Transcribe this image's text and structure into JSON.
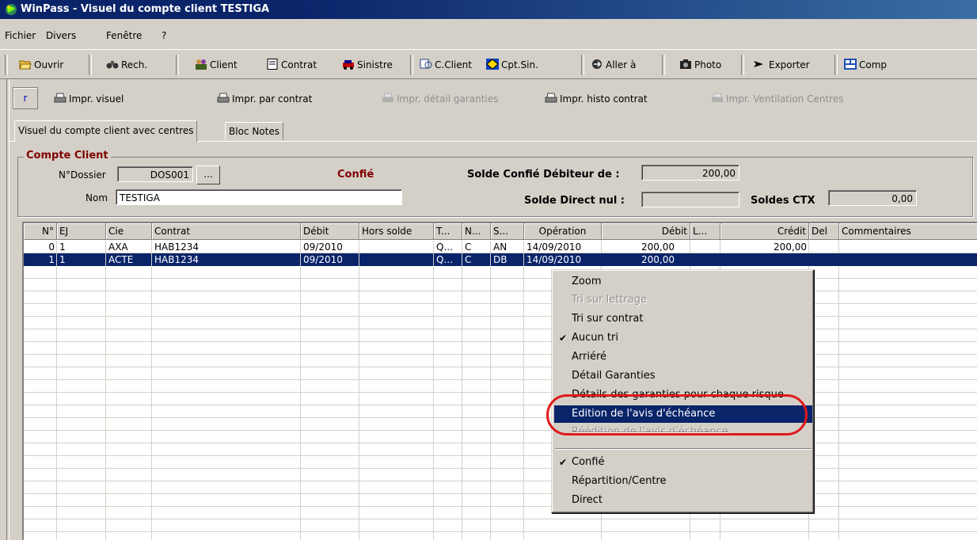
{
  "window": {
    "title": "WinPass - Visuel du compte client TESTIGA",
    "title_icon": "winpass-logo-icon"
  },
  "menu": [
    "Fichier",
    "Divers",
    "Fenêtre",
    "?"
  ],
  "toolbar": [
    {
      "label": "Ouvrir",
      "icon": "open-folder-icon"
    },
    {
      "label": "Rech.",
      "icon": "binoculars-icon"
    },
    {
      "label": "Client",
      "icon": "client-people-icon"
    },
    {
      "label": "Contrat",
      "icon": "document-icon"
    },
    {
      "label": "Sinistre",
      "icon": "car-crash-icon"
    },
    {
      "label": "C.Client",
      "icon": "account-icon"
    },
    {
      "label": "Cpt.Sin.",
      "icon": "warning-sign-icon"
    },
    {
      "label": "Aller à",
      "icon": "goto-icon"
    },
    {
      "label": "Photo",
      "icon": "camera-icon"
    },
    {
      "label": "Exporter",
      "icon": "export-arrow-icon"
    },
    {
      "label": "Comp",
      "icon": "compare-icon"
    }
  ],
  "print_toolbar": {
    "r_label": "r",
    "items": [
      {
        "label": "Impr. visuel",
        "enabled": true
      },
      {
        "label": "Impr. par contrat",
        "enabled": true
      },
      {
        "label": "Impr. détail garanties",
        "enabled": false
      },
      {
        "label": "Impr. histo contrat",
        "enabled": true
      },
      {
        "label": "Impr. Ventilation Centres",
        "enabled": false
      }
    ]
  },
  "tabs": [
    "Visuel du compte client avec centres",
    "Bloc Notes"
  ],
  "account": {
    "group_title": "Compte Client",
    "dossier_label": "N°Dossier",
    "dossier_value": "DOS001",
    "browse_label": "...",
    "confie_label": "Confié",
    "nom_label": "Nom",
    "nom_value": "TESTIGA",
    "solde_confie_label": "Solde Confié Débiteur de :",
    "solde_confie_value": "200,00",
    "solde_direct_label": "Solde Direct nul :",
    "solde_direct_value": "",
    "soldes_ctx_label": "Soldes CTX",
    "soldes_ctx_value": "0,00"
  },
  "table": {
    "headers": [
      "N°",
      "EJ",
      "Cie",
      "Contrat",
      "Débit",
      "Hors solde",
      "T...",
      "N...",
      "S...",
      "Opération",
      "Débit",
      "L...",
      "Crédit",
      "Del",
      "Commentaires"
    ],
    "rows": [
      {
        "n": "0",
        "ej": "1",
        "cie": "AXA",
        "contrat": "HAB1234",
        "debit_period": "09/2010",
        "hors_solde": "",
        "t": "Q...",
        "nn": "C",
        "s": "AN",
        "operation": "14/09/2010",
        "debit": "200,00",
        "l": "",
        "credit": "200,00",
        "del": "",
        "commentaires": ""
      },
      {
        "n": "1",
        "ej": "1",
        "cie": "ACTE",
        "contrat": "HAB1234",
        "debit_period": "09/2010",
        "hors_solde": "",
        "t": "Q...",
        "nn": "C",
        "s": "DB",
        "operation": "14/09/2010",
        "debit": "200,00",
        "l": "",
        "credit": "",
        "del": "",
        "commentaires": ""
      }
    ]
  },
  "context_menu": {
    "items": [
      {
        "label": "Zoom",
        "state": "normal",
        "checked": false
      },
      {
        "label": "Tri sur lettrage",
        "state": "disabled",
        "checked": false
      },
      {
        "label": "Tri sur contrat",
        "state": "normal",
        "checked": false
      },
      {
        "label": "Aucun tri",
        "state": "normal",
        "checked": true
      },
      {
        "label": "Arriéré",
        "state": "normal",
        "checked": false
      },
      {
        "label": "Détail Garanties",
        "state": "normal",
        "checked": false
      },
      {
        "label": "Détails des garanties pour chaque risque",
        "state": "normal",
        "checked": false
      },
      {
        "label": "Edition de l'avis d'échéance",
        "state": "highlighted",
        "checked": false
      },
      {
        "label": "Réédition de l'avis d'échéance",
        "state": "disabled",
        "checked": false
      },
      {
        "label": "Confié",
        "state": "normal",
        "checked": true
      },
      {
        "label": "Répartition/Centre",
        "state": "normal",
        "checked": false
      },
      {
        "label": "Direct",
        "state": "normal",
        "checked": false
      }
    ],
    "check_glyph": "✔",
    "annotation_color": "#e0191a"
  }
}
